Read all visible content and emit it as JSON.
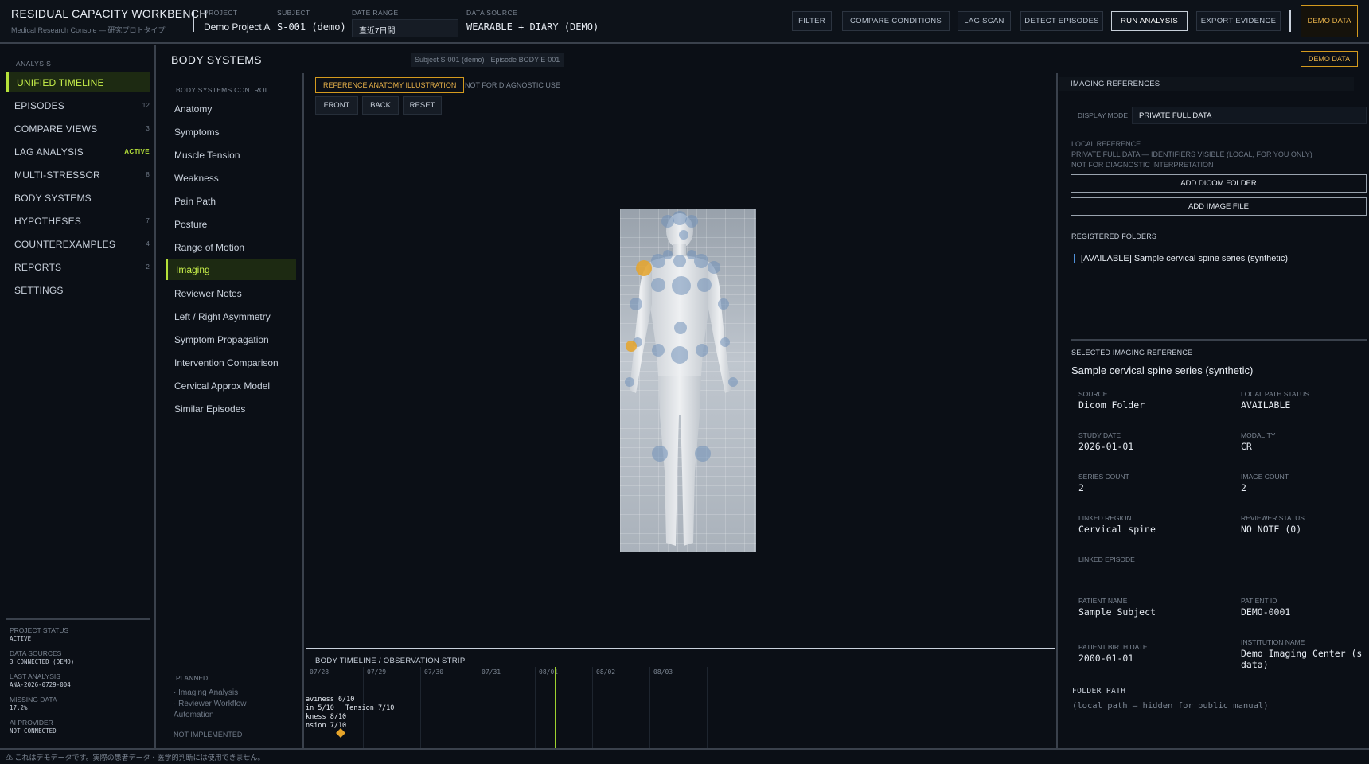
{
  "app": {
    "title": "RESIDUAL CAPACITY WORKBENCH",
    "subtitle": "Medical Research Console — 研究プロトタイプ"
  },
  "header": {
    "project_label": "PROJECT",
    "project_value": "Demo Project A",
    "subject_label": "SUBJECT",
    "subject_value": "S-001 (demo)",
    "daterange_label": "DATE RANGE",
    "daterange_value": "直近7日間",
    "datasource_label": "DATA SOURCE",
    "datasource_value": "WEARABLE + DIARY (DEMO)",
    "buttons": {
      "filter": "FILTER",
      "compare": "COMPARE CONDITIONS",
      "lag": "LAG SCAN",
      "detect": "DETECT EPISODES",
      "run": "RUN ANALYSIS",
      "export": "EXPORT EVIDENCE"
    },
    "demo_data": "DEMO DATA"
  },
  "leftnav": {
    "heading": "ANALYSIS",
    "items": [
      {
        "label": "UNIFIED TIMELINE",
        "badge": ""
      },
      {
        "label": "EPISODES",
        "badge": "12"
      },
      {
        "label": "COMPARE VIEWS",
        "badge": "3"
      },
      {
        "label": "LAG ANALYSIS",
        "badge": "ACTIVE"
      },
      {
        "label": "MULTI-STRESSOR",
        "badge": "8"
      },
      {
        "label": "BODY SYSTEMS",
        "badge": ""
      },
      {
        "label": "HYPOTHESES",
        "badge": "7"
      },
      {
        "label": "COUNTEREXAMPLES",
        "badge": "4"
      },
      {
        "label": "REPORTS",
        "badge": "2"
      },
      {
        "label": "SETTINGS",
        "badge": ""
      }
    ],
    "status": {
      "project_status_label": "PROJECT STATUS",
      "project_status": "ACTIVE",
      "data_sources_label": "DATA SOURCES",
      "data_sources": "3 CONNECTED (DEMO)",
      "last_analysis_label": "LAST ANALYSIS",
      "last_analysis": "ANA-2026-0729-004",
      "missing_label": "MISSING DATA",
      "missing": "17.2%",
      "ai_label": "AI PROVIDER",
      "ai": "NOT CONNECTED"
    }
  },
  "page": {
    "title": "BODY SYSTEMS",
    "crumb": "Subject S-001 (demo) · Episode BODY-E-001",
    "demo_data": "DEMO DATA"
  },
  "subnav": {
    "heading": "BODY SYSTEMS CONTROL",
    "items": [
      "Anatomy",
      "Symptoms",
      "Muscle Tension",
      "Weakness",
      "Pain Path",
      "Posture",
      "Range of Motion",
      "Imaging",
      "Reviewer Notes",
      "Left / Right Asymmetry",
      "Symptom Propagation",
      "Intervention Comparison",
      "Cervical Approx Model",
      "Similar Episodes"
    ],
    "planned_heading": "PLANNED",
    "planned_items": [
      "· Imaging Analysis",
      "· Reviewer Workflow",
      "Automation"
    ],
    "planned_footer": "NOT IMPLEMENTED"
  },
  "center": {
    "reference_button": "REFERENCE ANATOMY ILLUSTRATION",
    "not_diagnostic": "NOT FOR DIAGNOSTIC USE",
    "view_buttons": {
      "front": "FRONT",
      "back": "BACK",
      "reset": "RESET"
    },
    "strip_title": "BODY TIMELINE / OBSERVATION STRIP",
    "strip_dates": [
      "07/28",
      "07/29",
      "07/30",
      "07/31",
      "08/01",
      "08/02",
      "08/03"
    ],
    "strip_notes": [
      "aviness 6/10",
      "in 5/10",
      "Tension 7/10",
      "kness 8/10",
      "nsion 7/10"
    ]
  },
  "right": {
    "heading": "IMAGING REFERENCES",
    "display_mode_label": "DISPLAY MODE",
    "display_mode_value": "PRIVATE FULL DATA",
    "local_ref_lines": [
      "LOCAL REFERENCE",
      "PRIVATE FULL DATA — IDENTIFIERS VISIBLE (LOCAL, FOR YOU ONLY)",
      "NOT FOR DIAGNOSTIC INTERPRETATION"
    ],
    "add_dicom": "ADD DICOM FOLDER",
    "add_image": "ADD IMAGE FILE",
    "registered_label": "REGISTERED FOLDERS",
    "registered_item": "[AVAILABLE] Sample cervical spine series (synthetic)",
    "selected_label": "SELECTED IMAGING REFERENCE",
    "selected_title": "Sample cervical spine series (synthetic)",
    "fields": {
      "source_k": "SOURCE",
      "source_v": "Dicom Folder",
      "lps_k": "LOCAL PATH STATUS",
      "lps_v": "AVAILABLE",
      "study_k": "STUDY DATE",
      "study_v": "2026-01-01",
      "modality_k": "MODALITY",
      "modality_v": "CR",
      "series_k": "SERIES COUNT",
      "series_v": "2",
      "imgcount_k": "IMAGE COUNT",
      "imgcount_v": "2",
      "region_k": "LINKED REGION",
      "region_v": "Cervical spine",
      "reviewer_k": "REVIEWER STATUS",
      "reviewer_v": "NO NOTE (0)",
      "episode_k": "LINKED EPISODE",
      "episode_v": "—",
      "pname_k": "PATIENT NAME",
      "pname_v": "Sample Subject",
      "pid_k": "PATIENT ID",
      "pid_v": "DEMO-0001",
      "birth_k": "PATIENT BIRTH DATE",
      "birth_v": "2000-01-01",
      "inst_k": "INSTITUTION NAME",
      "inst_v": "Demo Imaging Center (s data)"
    },
    "folder_path_label": "FOLDER PATH",
    "folder_path_value": "(local path — hidden for public manual)"
  },
  "footer": {
    "notice": "⚠ これはデモデータです。実際の患者データ・医学的判断には使用できません。"
  },
  "colors": {
    "accent": "#b5e03a",
    "warning": "#d49a1e",
    "hotspot": "#e6a42a",
    "marker": "#6f8fb8"
  }
}
